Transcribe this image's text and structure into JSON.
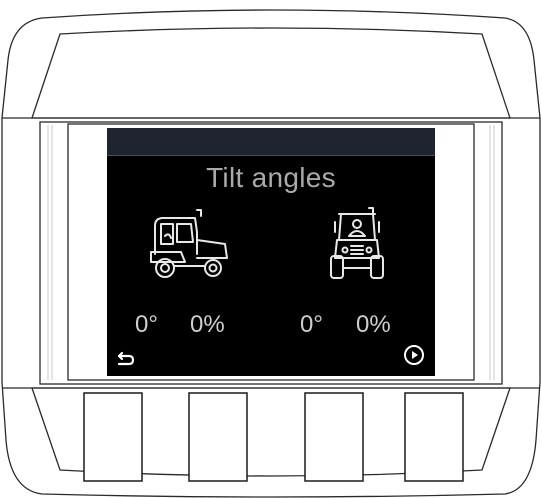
{
  "screen": {
    "title": "Tilt angles",
    "side_view": {
      "angle": "0°",
      "percent": "0%",
      "icon": "tractor-side-view-icon"
    },
    "front_view": {
      "angle": "0°",
      "percent": "0%",
      "icon": "tractor-front-view-icon"
    },
    "back_icon": "return-arrow-icon",
    "next_icon": "circled-play-icon"
  },
  "softkeys": [
    {
      "id": "softkey-1",
      "label": ""
    },
    {
      "id": "softkey-2",
      "label": ""
    },
    {
      "id": "softkey-3",
      "label": ""
    },
    {
      "id": "softkey-4",
      "label": ""
    }
  ],
  "colors": {
    "screen_bg": "#000000",
    "title": "#aaaaaa",
    "values": "#cfcfcf",
    "header": "#1f2430"
  }
}
